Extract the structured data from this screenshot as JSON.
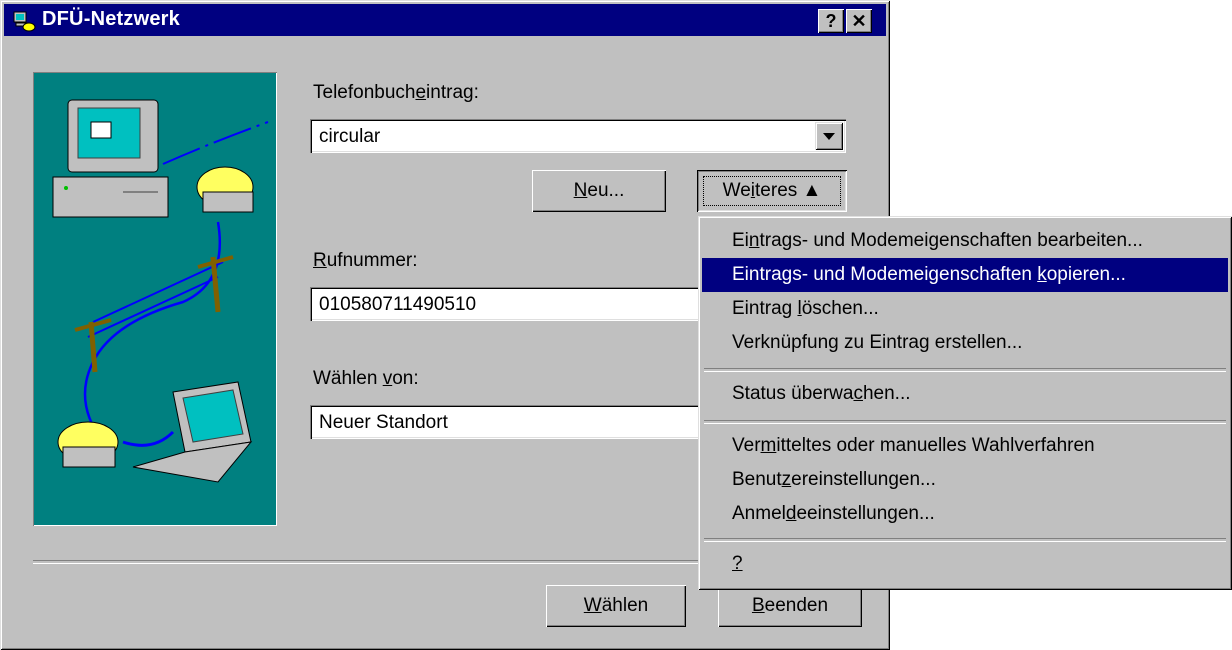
{
  "window": {
    "title": "DFÜ-Netzwerk",
    "help_glyph": "?",
    "close_glyph": "✕"
  },
  "phonebook": {
    "label": "Telefonbuch",
    "label_ul": "e",
    "label_end": "intrag:",
    "value": "circular"
  },
  "buttons": {
    "new_pre": "",
    "new_ul": "N",
    "new_post": "eu...",
    "more_pre": "We",
    "more_ul": "i",
    "more_post": "teres ▲",
    "dial_pre": "",
    "dial_ul": "W",
    "dial_post": "ählen",
    "quit_pre": "",
    "quit_ul": "B",
    "quit_post": "eenden"
  },
  "number": {
    "label_ul": "R",
    "label_rest": "ufnummer:",
    "value": "010580711490510"
  },
  "dialfrom": {
    "label_pre": "Wählen ",
    "label_ul": "v",
    "label_post": "on:",
    "value": "Neuer Standort"
  },
  "menu": {
    "items": [
      {
        "pre": "Ei",
        "ul": "n",
        "post": "trags- und Modemeigenschaften bearbeiten..."
      },
      {
        "pre": "Eintrags- und Modemeigenschaften ",
        "ul": "k",
        "post": "opieren..."
      },
      {
        "pre": "Eintrag ",
        "ul": "l",
        "post": "öschen..."
      },
      {
        "pre": "Verknüpfung zu Eintrag erstellen...",
        "ul": "",
        "post": ""
      },
      {
        "pre": "Status überwa",
        "ul": "c",
        "post": "hen..."
      },
      {
        "pre": "Ver",
        "ul": "m",
        "post": "itteltes oder manuelles Wahlverfahren"
      },
      {
        "pre": "Benut",
        "ul": "z",
        "post": "ereinstellungen..."
      },
      {
        "pre": "Anmel",
        "ul": "d",
        "post": "eeinstellungen..."
      },
      {
        "pre": "",
        "ul": "?",
        "post": ""
      }
    ]
  },
  "colors": {
    "titlebar": "#000080",
    "face": "#c0c0c0",
    "illustration_bg": "#008080",
    "highlight": "#000080"
  }
}
